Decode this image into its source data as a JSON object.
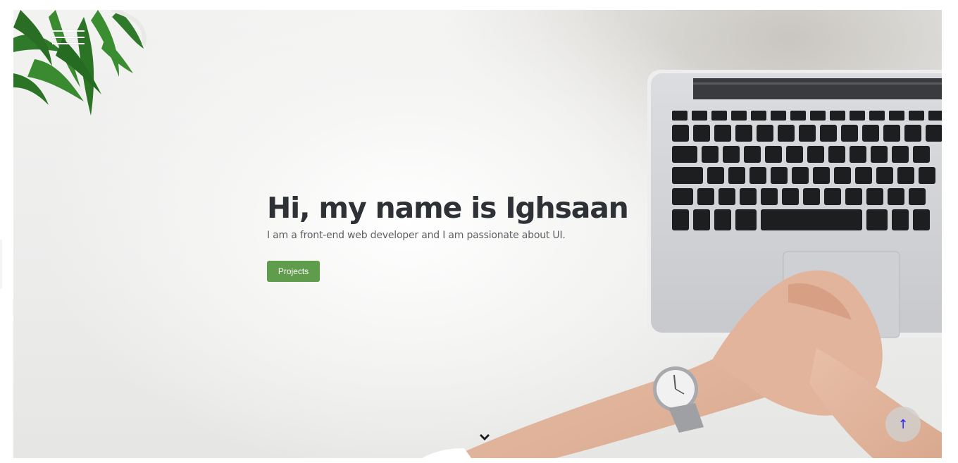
{
  "hero": {
    "heading": "Hi, my name is Ighsaan",
    "tagline": "I am a front-end web developer and I am passionate about UI.",
    "projects_button": "Projects",
    "scroll_to_top": "↑"
  },
  "icons": {
    "menu": "hamburger-menu-icon",
    "scroll_down": "chevron-down-icon"
  },
  "colors": {
    "button_bg": "#5f9c4b",
    "heading": "#2e3236",
    "tagline": "#5c5f62",
    "top_button_arrow": "#2a2aff"
  }
}
